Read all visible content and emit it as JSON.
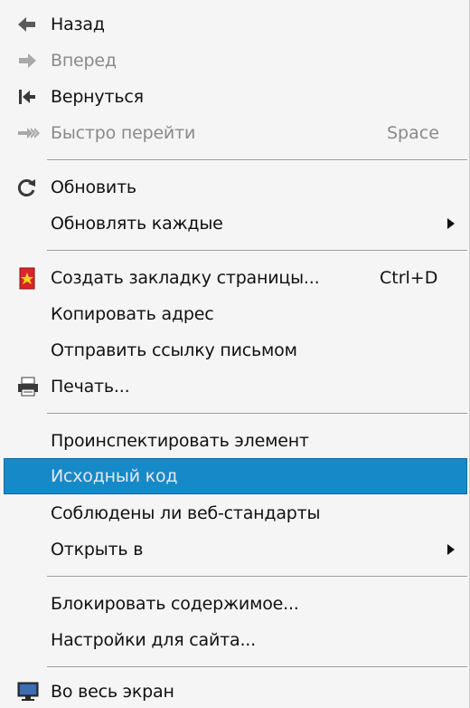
{
  "menu": {
    "back": {
      "label": "Назад",
      "icon": "back-arrow-icon"
    },
    "forward": {
      "label": "Вперед",
      "icon": "forward-arrow-icon"
    },
    "rewind": {
      "label": "Вернуться",
      "icon": "rewind-icon"
    },
    "fast_forward": {
      "label": "Быстро перейти",
      "shortcut": "Space",
      "icon": "fast-forward-icon"
    },
    "reload": {
      "label": "Обновить",
      "icon": "reload-icon"
    },
    "reload_every": {
      "label": "Обновлять каждые"
    },
    "bookmark": {
      "label": "Создать закладку страницы...",
      "shortcut": "Ctrl+D",
      "icon": "bookmark-icon"
    },
    "copy_address": {
      "label": "Копировать адрес"
    },
    "send_link": {
      "label": "Отправить ссылку письмом"
    },
    "print": {
      "label": "Печать...",
      "icon": "printer-icon"
    },
    "inspect": {
      "label": "Проинспектировать элемент"
    },
    "source": {
      "label": "Исходный код"
    },
    "validate": {
      "label": "Соблюдены ли веб-стандарты"
    },
    "open_with": {
      "label": "Открыть в"
    },
    "block_content": {
      "label": "Блокировать содержимое..."
    },
    "site_prefs": {
      "label": "Настройки для сайта..."
    },
    "fullscreen": {
      "label": "Во весь экран",
      "icon": "fullscreen-monitor-icon"
    }
  },
  "colors": {
    "background": "#f5f5f5",
    "highlight": "#1689c9",
    "disabled_text": "#8a8a8a",
    "bookmark_red": "#d9252a",
    "bookmark_star": "#f6d21a"
  }
}
